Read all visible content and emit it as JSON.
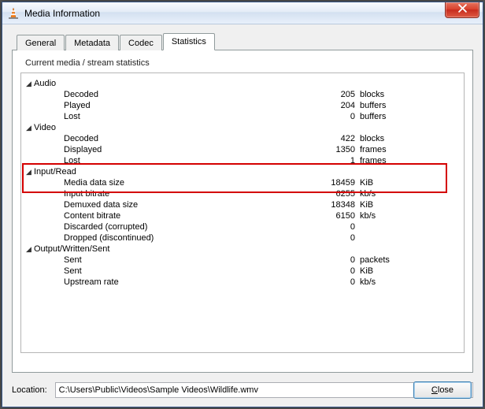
{
  "window": {
    "title": "Media Information"
  },
  "tabs": {
    "general": "General",
    "metadata": "Metadata",
    "codec": "Codec",
    "statistics": "Statistics"
  },
  "stats": {
    "heading": "Current media / stream statistics",
    "audio": {
      "title": "Audio",
      "decoded": {
        "label": "Decoded",
        "value": "205",
        "unit": "blocks"
      },
      "played": {
        "label": "Played",
        "value": "204",
        "unit": "buffers"
      },
      "lost": {
        "label": "Lost",
        "value": "0",
        "unit": "buffers"
      }
    },
    "video": {
      "title": "Video",
      "decoded": {
        "label": "Decoded",
        "value": "422",
        "unit": "blocks"
      },
      "displayed": {
        "label": "Displayed",
        "value": "1350",
        "unit": "frames"
      },
      "lost": {
        "label": "Lost",
        "value": "1",
        "unit": "frames"
      }
    },
    "input": {
      "title": "Input/Read",
      "media_size": {
        "label": "Media data size",
        "value": "18459",
        "unit": "KiB"
      },
      "input_bitrate": {
        "label": "Input bitrate",
        "value": "6255",
        "unit": "kb/s"
      },
      "demuxed_size": {
        "label": "Demuxed data size",
        "value": "18348",
        "unit": "KiB"
      },
      "content_bitrate": {
        "label": "Content bitrate",
        "value": "6150",
        "unit": "kb/s"
      },
      "discarded": {
        "label": "Discarded (corrupted)",
        "value": "0",
        "unit": ""
      },
      "dropped": {
        "label": "Dropped (discontinued)",
        "value": "0",
        "unit": ""
      }
    },
    "output": {
      "title": "Output/Written/Sent",
      "sent_packets": {
        "label": "Sent",
        "value": "0",
        "unit": "packets"
      },
      "sent_kib": {
        "label": "Sent",
        "value": "0",
        "unit": "KiB"
      },
      "up_rate": {
        "label": "Upstream rate",
        "value": "0",
        "unit": "kb/s"
      }
    }
  },
  "location": {
    "label": "Location:",
    "value": "C:\\Users\\Public\\Videos\\Sample Videos\\Wildlife.wmv"
  },
  "buttons": {
    "close": "Close"
  },
  "triangle": "◢"
}
